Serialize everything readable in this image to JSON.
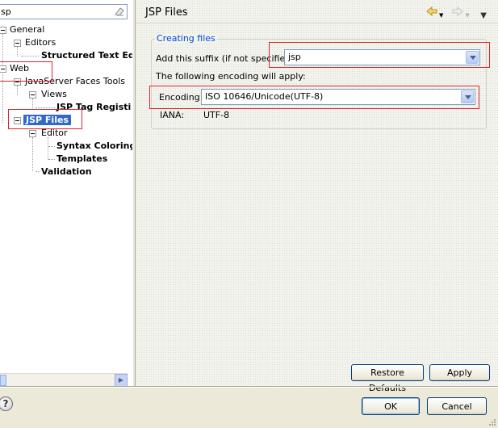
{
  "filter": {
    "value": "sp"
  },
  "tree": {
    "general": "General",
    "editors": "Editors",
    "structured_text": "Structured Text Ed",
    "web": "Web",
    "jsf_tools": "JavaServer Faces Tools",
    "views": "Views",
    "jsp_tag": "JSP Tag Registi",
    "jsp_files": "JSP Files",
    "editor": "Editor",
    "syntax_coloring": "Syntax Coloring",
    "templates": "Templates",
    "validation": "Validation"
  },
  "page": {
    "title": "JSP Files",
    "group_title": "Creating files",
    "suffix_label": "Add this suffix (if not specified):",
    "suffix_value": "jsp",
    "encoding_note": "The following encoding will apply:",
    "encoding_label": "Encoding:",
    "encoding_value": "ISO 10646/Unicode(UTF-8)",
    "iana_label": "IANA:",
    "iana_value": "UTF-8"
  },
  "buttons": {
    "restore_defaults": "Restore Defaults",
    "apply": "Apply",
    "ok": "OK",
    "cancel": "Cancel"
  },
  "icons": {
    "help": "?"
  },
  "colors": {
    "highlight_box": "#d7262e",
    "selection": "#316ac5",
    "group_title": "#0046d5"
  }
}
